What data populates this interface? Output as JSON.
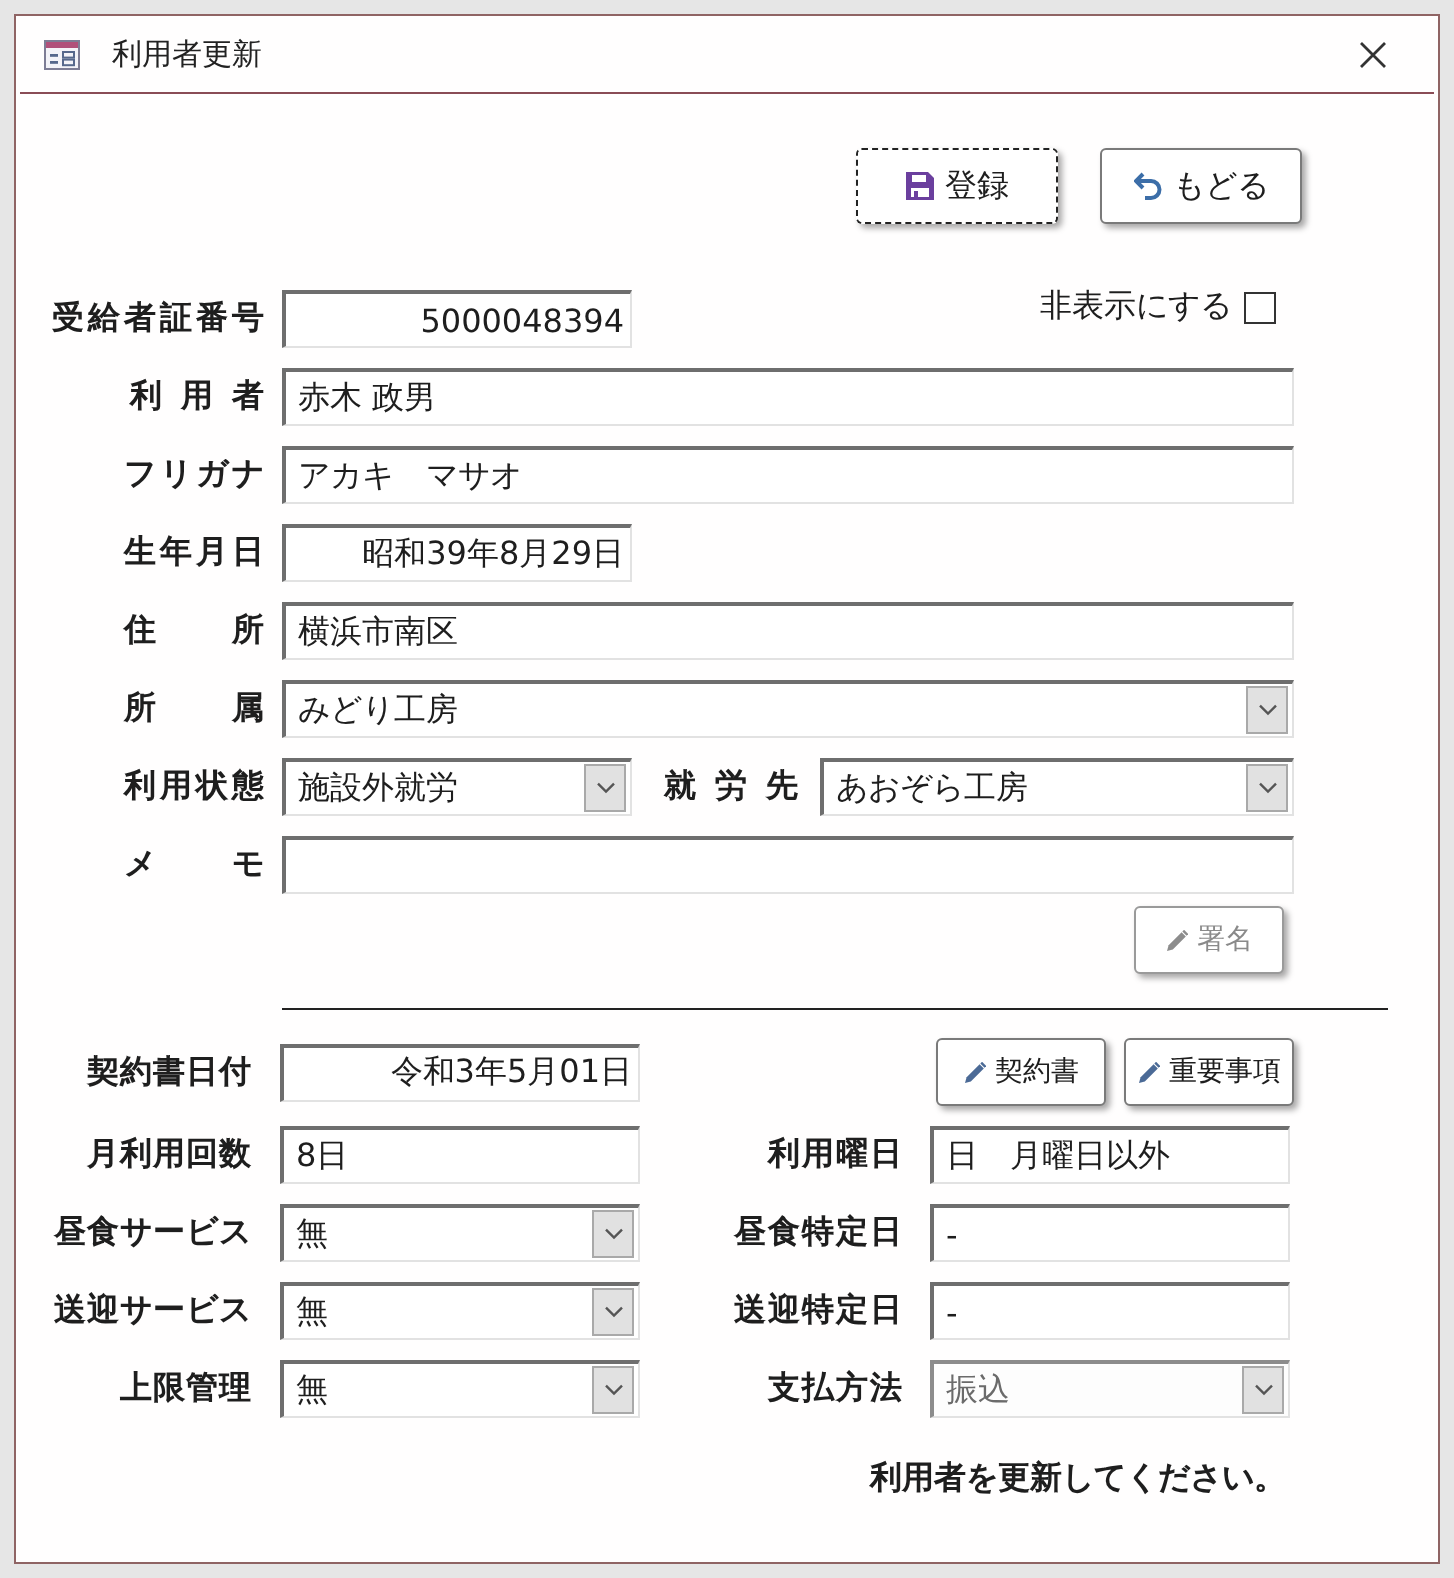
{
  "window": {
    "title": "利用者更新"
  },
  "toolbar": {
    "buttons": [
      {
        "kind": "save",
        "label": "登録",
        "focused": true
      },
      {
        "kind": "back",
        "label": "もどる",
        "focused": false
      }
    ]
  },
  "hide_checkbox": {
    "label": "非表示にする",
    "checked": false
  },
  "upper_rows": [
    [
      {
        "label": "受給者証番号",
        "kind": "number",
        "value": "5000048394",
        "disabled": false
      }
    ],
    [
      {
        "label": "利 用 者",
        "kind": "text",
        "value": "赤木 政男",
        "disabled": false
      }
    ],
    [
      {
        "label": "フリガナ",
        "kind": "text",
        "value": "アカキ　マサオ",
        "disabled": false
      }
    ],
    [
      {
        "label": "生年月日",
        "kind": "date",
        "value": "昭和39年8月29日",
        "disabled": false
      }
    ],
    [
      {
        "label": "住　　所",
        "kind": "text",
        "value": "横浜市南区",
        "disabled": false
      }
    ],
    [
      {
        "label": "所　　属",
        "kind": "select",
        "value": "みどり工房",
        "disabled": false
      }
    ],
    [
      {
        "label": "利用状態",
        "kind": "select",
        "value": "施設外就労",
        "disabled": false
      },
      {
        "label": "就 労 先",
        "kind": "select",
        "value": "あおぞら工房",
        "disabled": false
      }
    ],
    [
      {
        "label": "メ　　モ",
        "kind": "text",
        "disabled": false
      }
    ]
  ],
  "sign_button": {
    "label": "署名",
    "disabled": true
  },
  "lower_rows": [
    {
      "left": {
        "label": "契約書日付",
        "kind": "date",
        "value": "令和3年5月01日",
        "disabled": false
      },
      "buttons": [
        {
          "label": "契約書",
          "disabled": false
        },
        {
          "label": "重要事項",
          "disabled": false
        }
      ]
    },
    {
      "left": {
        "label": "月利用回数",
        "kind": "text",
        "value": "8日",
        "disabled": false
      },
      "right": {
        "label": "利用曜日",
        "kind": "text",
        "value": "日　月曜日以外",
        "disabled": false
      }
    },
    {
      "left": {
        "label": "昼食サービス",
        "kind": "select",
        "value": "無",
        "disabled": false
      },
      "right": {
        "label": "昼食特定日",
        "kind": "text",
        "value": "-",
        "disabled": false
      }
    },
    {
      "left": {
        "label": "送迎サービス",
        "kind": "select",
        "value": "無",
        "disabled": false
      },
      "right": {
        "label": "送迎特定日",
        "kind": "text",
        "value": "-",
        "disabled": false
      }
    },
    {
      "left": {
        "label": "上限管理",
        "kind": "select",
        "value": "無",
        "disabled": false
      },
      "right": {
        "label": "支払方法",
        "kind": "select",
        "value": "振込",
        "disabled": true
      }
    }
  ],
  "status_message": "利用者を更新してください。"
}
